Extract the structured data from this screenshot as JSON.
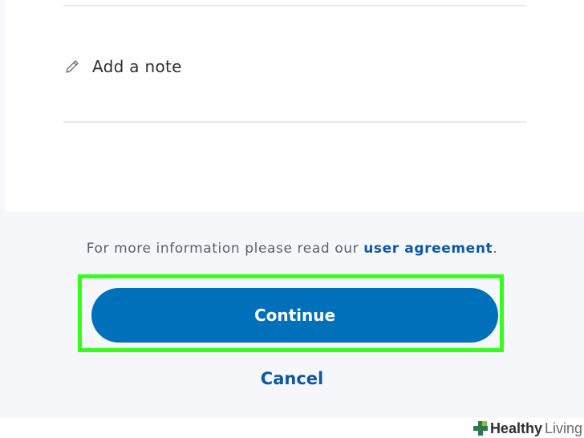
{
  "note": {
    "label": "Add a note",
    "icon": "pencil-icon"
  },
  "info": {
    "prefix": "For more information please read our",
    "link": "user agreement",
    "suffix": "."
  },
  "actions": {
    "continue_label": "Continue",
    "cancel_label": "Cancel"
  },
  "watermark": {
    "part1": "Healthy",
    "part2": "Living"
  },
  "colors": {
    "primary": "#0070ba",
    "link": "#0d57a6",
    "highlight": "#33ff1a",
    "background": "#f5f7fa"
  }
}
